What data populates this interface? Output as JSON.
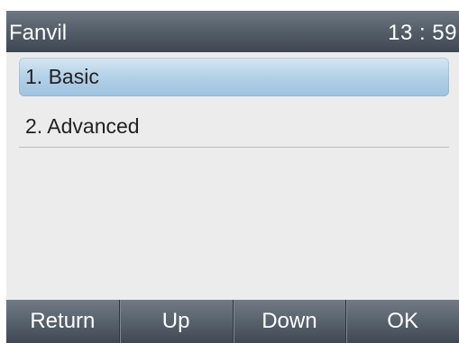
{
  "status_bar": {
    "brand": "Fanvil",
    "time": "13 : 59"
  },
  "menu": {
    "items": [
      {
        "label": "1. Basic",
        "selected": true
      },
      {
        "label": "2. Advanced",
        "selected": false
      }
    ]
  },
  "softkeys": {
    "return_label": "Return",
    "up_label": "Up",
    "down_label": "Down",
    "ok_label": "OK"
  },
  "colors": {
    "status_bar": "#56606b",
    "selection": "#b3d0e7",
    "screen_background": "#ececec"
  }
}
